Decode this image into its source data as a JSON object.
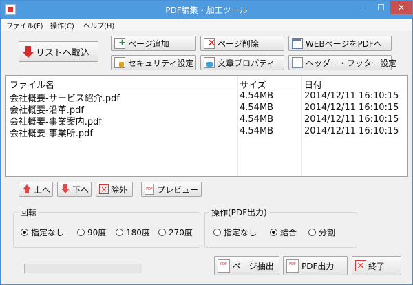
{
  "window": {
    "title": "PDF編集・加工ツール"
  },
  "menu": [
    {
      "label": "ファイル(F)"
    },
    {
      "label": "操作(C)"
    },
    {
      "label": "ヘルプ(H)"
    }
  ],
  "toolbar": {
    "import_list": "リストへ取込",
    "add_page": "ページ追加",
    "delete_page": "ページ削除",
    "web_to_pdf": "WEBページをPDFへ",
    "security": "セキュリティ設定",
    "doc_props": "文章プロパティ",
    "header_footer": "ヘッダー・フッター設定"
  },
  "table": {
    "columns": [
      "ファイル名",
      "サイズ",
      "日付"
    ],
    "rows": [
      {
        "name": "会社概要-サービス紹介.pdf",
        "size": "4.54MB",
        "date": "2014/12/11 16:10:15"
      },
      {
        "name": "会社概要-沿革.pdf",
        "size": "4.54MB",
        "date": "2014/12/11 16:10:15"
      },
      {
        "name": "会社概要-事業案内.pdf",
        "size": "4.54MB",
        "date": "2014/12/11 16:10:15"
      },
      {
        "name": "会社概要-事業所.pdf",
        "size": "4.54MB",
        "date": "2014/12/11 16:10:15"
      }
    ]
  },
  "list_actions": {
    "up": "上へ",
    "down": "下へ",
    "remove": "除外",
    "preview": "プレビュー"
  },
  "rotation": {
    "title": "回転",
    "options": [
      "指定なし",
      "90度",
      "180度",
      "270度"
    ],
    "selected": "指定なし"
  },
  "operation": {
    "title": "操作(PDF出力)",
    "options": [
      "指定なし",
      "結合",
      "分割"
    ],
    "selected": "結合"
  },
  "bottom": {
    "extract": "ページ抽出",
    "pdf_output": "PDF出力",
    "exit": "終了"
  },
  "progress": {
    "value": 0
  },
  "colors": {
    "titlebar": "#4e9be0",
    "accent_red": "#d62b2b"
  }
}
